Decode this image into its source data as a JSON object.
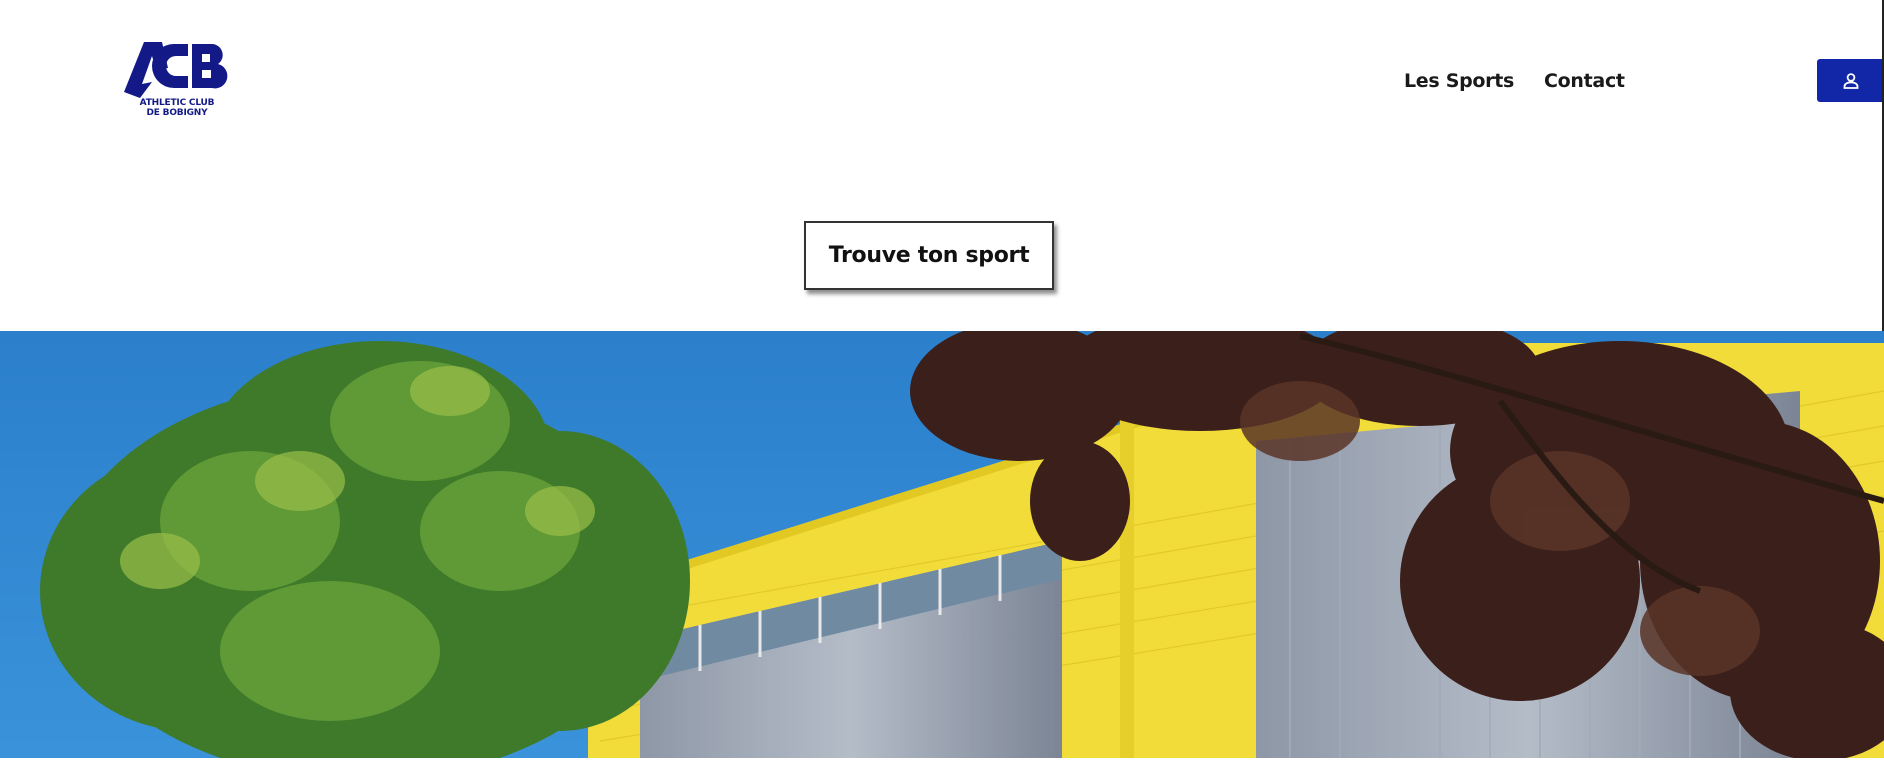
{
  "brand": {
    "logo_letters": "ACB",
    "logo_line1": "ATHLETIC CLUB",
    "logo_line2": "DE BOBIGNY",
    "color": "#131a87"
  },
  "nav": {
    "items": [
      {
        "label": "Les Sports"
      },
      {
        "label": "Contact"
      }
    ]
  },
  "account": {
    "icon": "user-icon",
    "color": "#1226a8"
  },
  "cta": {
    "label": "Trouve ton sport"
  },
  "hero": {
    "icon": "gymnasium-photo",
    "sky_color": "#2f86cf",
    "building_color": "#f2dc3a"
  }
}
